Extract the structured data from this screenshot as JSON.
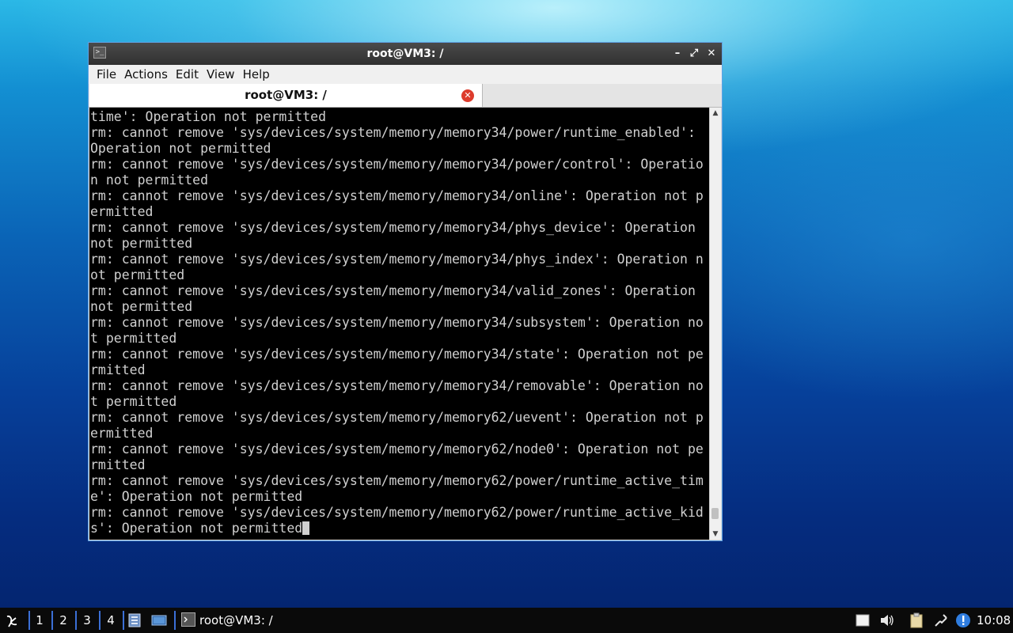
{
  "window": {
    "title": "root@VM3: /",
    "menu": [
      "File",
      "Actions",
      "Edit",
      "View",
      "Help"
    ],
    "tab_label": "root@VM3: /"
  },
  "terminal": {
    "lines": [
      "time': Operation not permitted",
      "rm: cannot remove 'sys/devices/system/memory/memory34/power/runtime_enabled':",
      "Operation not permitted",
      "rm: cannot remove 'sys/devices/system/memory/memory34/power/control': Operatio",
      "n not permitted",
      "rm: cannot remove 'sys/devices/system/memory/memory34/online': Operation not p",
      "ermitted",
      "rm: cannot remove 'sys/devices/system/memory/memory34/phys_device': Operation",
      "not permitted",
      "rm: cannot remove 'sys/devices/system/memory/memory34/phys_index': Operation n",
      "ot permitted",
      "rm: cannot remove 'sys/devices/system/memory/memory34/valid_zones': Operation",
      "not permitted",
      "rm: cannot remove 'sys/devices/system/memory/memory34/subsystem': Operation no",
      "t permitted",
      "rm: cannot remove 'sys/devices/system/memory/memory34/state': Operation not pe",
      "rmitted",
      "rm: cannot remove 'sys/devices/system/memory/memory34/removable': Operation no",
      "t permitted",
      "rm: cannot remove 'sys/devices/system/memory/memory62/uevent': Operation not p",
      "ermitted",
      "rm: cannot remove 'sys/devices/system/memory/memory62/node0': Operation not pe",
      "rmitted",
      "rm: cannot remove 'sys/devices/system/memory/memory62/power/runtime_active_tim",
      "e': Operation not permitted",
      "rm: cannot remove 'sys/devices/system/memory/memory62/power/runtime_active_kid",
      "s': Operation not permitted"
    ]
  },
  "taskbar": {
    "workspaces": [
      "1",
      "2",
      "3",
      "4"
    ],
    "task_label": "root@VM3: /",
    "clock": "10:08"
  },
  "colors": {
    "terminal_bg": "#000000",
    "terminal_fg": "#d0d0d0",
    "accent": "#3b6fd6",
    "close_button": "#dd3b2c"
  },
  "icons": [
    "start-menu-icon",
    "file-manager-icon",
    "desktop-icon",
    "terminal-icon",
    "notes-icon",
    "volume-icon",
    "clipboard-icon",
    "network-icon",
    "update-icon"
  ]
}
